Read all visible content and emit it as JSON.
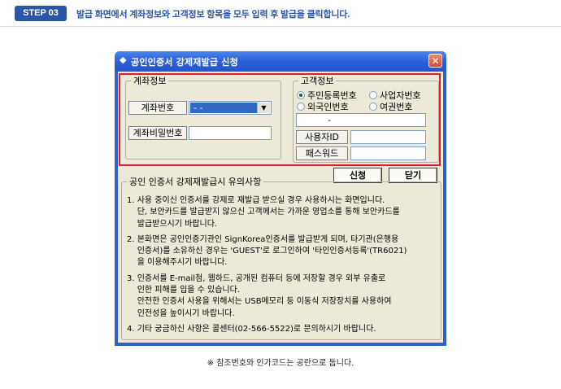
{
  "header": {
    "step_label": "STEP 03",
    "instruction": "발급 화면에서 계좌정보와 고객정보 항목을 모두 입력 후 발급을 클릭합니다."
  },
  "window": {
    "title_glyph": "◆",
    "title": "공인인증서 강제재발급 신청",
    "close_glyph": "✕"
  },
  "account_info": {
    "legend": "계좌정보",
    "account_number_button": "계좌번호",
    "account_number_value": "-  -",
    "account_password_label": "계좌비밀번호",
    "account_password_value": ""
  },
  "customer_info": {
    "legend": "고객정보",
    "radio_options": [
      {
        "label": "주민등록번호",
        "selected": true
      },
      {
        "label": "사업자번호",
        "selected": false
      },
      {
        "label": "외국인번호",
        "selected": false
      },
      {
        "label": "여권번호",
        "selected": false
      }
    ],
    "id_number_value": "-",
    "user_id_button": "사용자ID",
    "user_id_value": "",
    "password_button": "패스워드",
    "password_value": ""
  },
  "actions": {
    "apply_label": "신청",
    "close_label": "닫기"
  },
  "notice": {
    "legend": "공인 인증서 강제재발급시 유의사항",
    "items": [
      "1. 사용 중이신 인증서를 강제로 재발급 받으실 경우 사용하시는 화면입니다.\n    단, 보안카드를 발급받지 않으신 고객께서는 가까운 영업소를 통해 보안카드를\n    발급받으시기 바랍니다.",
      "2. 본화면은 공인인증기관인 SignKorea인증서를 발급받게 되며, 타기관(은행용\n    인증서)를 소유하신 경우는 'GUEST'로 로그인하여 '타인인증서등록'(TR6021)\n    을 이용해주시기 바랍니다.",
      "3. 인증서를 E-mail첨, 웹하드, 공개된 컴퓨터 등에 저장할 경우 외부 유출로\n    인한 피해를 입을 수 있습니다.\n    안전한 인증서 사용을 위해서는 USB메모리 등 이동식 저장장치를 사용하여\n    인전성을 높이시기 바랍니다.",
      "4. 기타 궁금하신 사항은 콜센터(02-566-5522)로 문의하시기 바랍니다."
    ]
  },
  "footer": {
    "note": "※ 참조번호와 인가코드는 공란으로 둡니다."
  },
  "colors": {
    "accent": "#2b56a8",
    "title_bar": "#2a5fd8",
    "highlight_border": "#d8202a",
    "dialog_bg": "#ece9d8"
  }
}
